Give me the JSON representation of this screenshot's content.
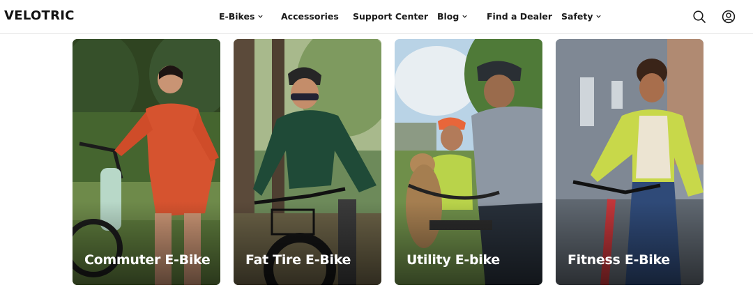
{
  "header": {
    "logo": "VELOTRIC",
    "nav": [
      {
        "label": "E-Bikes",
        "has_dropdown": true
      },
      {
        "label": "Accessories",
        "has_dropdown": false
      },
      {
        "label": "Support Center",
        "has_dropdown": false
      },
      {
        "label": "Blog",
        "has_dropdown": true
      },
      {
        "label": "Find a Dealer",
        "has_dropdown": false
      },
      {
        "label": "Safety",
        "has_dropdown": true
      }
    ],
    "icons": [
      "search-icon",
      "account-icon"
    ]
  },
  "categories": [
    {
      "label": "Commuter E-Bike"
    },
    {
      "label": "Fat Tire E-Bike"
    },
    {
      "label": "Utility E-bike"
    },
    {
      "label": "Fitness E-Bike"
    }
  ],
  "colors": {
    "text": "#1a1a1a",
    "card_label": "#ffffff",
    "divider": "#e4e4e4"
  }
}
